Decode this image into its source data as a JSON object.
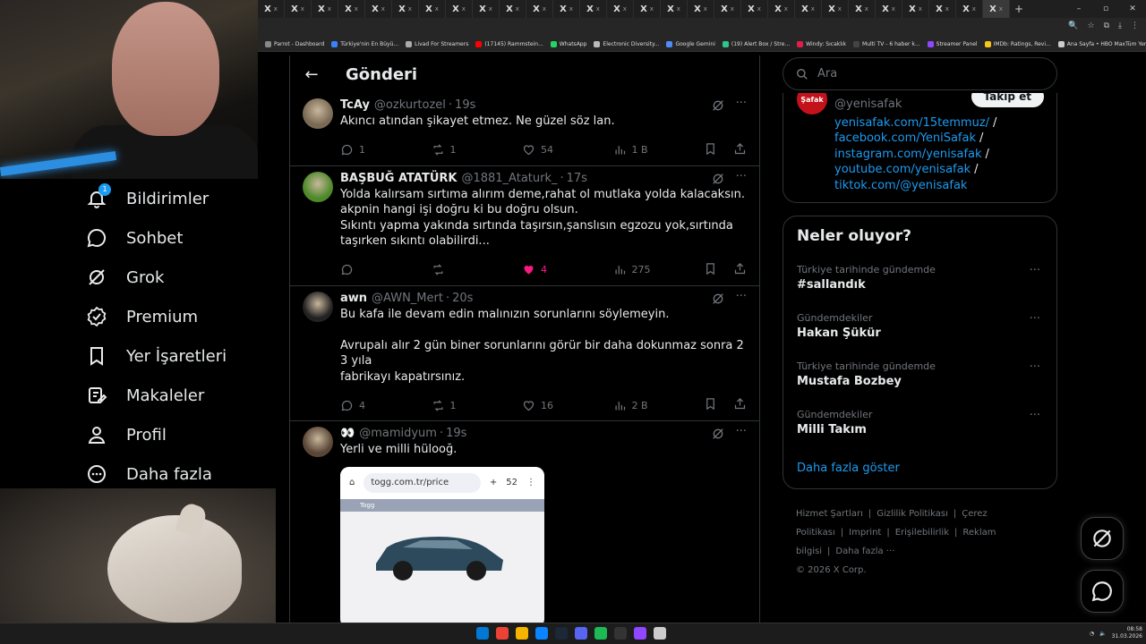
{
  "browser": {
    "tabs": [
      {
        "icon": "x-icon",
        "label": "X",
        "close": "x"
      },
      {
        "icon": "x-icon",
        "label": "X",
        "close": "x"
      },
      {
        "icon": "x-icon",
        "label": "X",
        "close": "x"
      },
      {
        "icon": "x-icon",
        "label": "X",
        "close": "x"
      },
      {
        "icon": "x-icon",
        "label": "X",
        "close": "x"
      },
      {
        "icon": "x-icon",
        "label": "X",
        "close": "x"
      },
      {
        "icon": "x-icon",
        "label": "X",
        "close": "x"
      },
      {
        "icon": "x-icon",
        "label": "X",
        "close": "x"
      },
      {
        "icon": "x-icon",
        "label": "X",
        "close": "x"
      },
      {
        "icon": "x-icon",
        "label": "X",
        "close": "x"
      },
      {
        "icon": "x-icon",
        "label": "X",
        "close": "x"
      },
      {
        "icon": "x-icon",
        "label": "X",
        "close": "x"
      },
      {
        "icon": "x-icon",
        "label": "X",
        "close": "x"
      },
      {
        "icon": "x-icon",
        "label": "X",
        "close": "x"
      },
      {
        "icon": "x-icon",
        "label": "X",
        "close": "x"
      },
      {
        "icon": "x-icon",
        "label": "X",
        "close": "x"
      },
      {
        "icon": "x-icon",
        "label": "X",
        "close": "x"
      },
      {
        "icon": "x-icon",
        "label": "X",
        "close": "x"
      },
      {
        "icon": "x-icon",
        "label": "X",
        "close": "x"
      },
      {
        "icon": "x-icon",
        "label": "X",
        "close": "x"
      },
      {
        "icon": "x-icon",
        "label": "X",
        "close": "x"
      },
      {
        "icon": "x-icon",
        "label": "X",
        "close": "x"
      },
      {
        "icon": "x-icon",
        "label": "X",
        "close": "x"
      },
      {
        "icon": "x-icon",
        "label": "X",
        "close": "x"
      },
      {
        "icon": "x-icon",
        "label": "X",
        "close": "x"
      },
      {
        "icon": "x-icon",
        "label": "X",
        "close": "x"
      },
      {
        "icon": "x-icon",
        "label": "X",
        "close": "x"
      },
      {
        "icon": "x-icon",
        "label": "X",
        "close": "x",
        "active": true
      }
    ],
    "new_tab": "+",
    "window_controls": [
      "–",
      "▫",
      "✕"
    ],
    "bookmarks": [
      {
        "label": "Parrot - Dashboard",
        "color": "#888888"
      },
      {
        "label": "Türkiye'nin En Büyü...",
        "color": "#3b82f6"
      },
      {
        "label": "Livad For Streamers",
        "color": "#aaaaaa"
      },
      {
        "label": "(17145) Rammstein...",
        "color": "#ff0000"
      },
      {
        "label": "WhatsApp",
        "color": "#25d366"
      },
      {
        "label": "Electronic Diversity...",
        "color": "#bbbbbb"
      },
      {
        "label": "Google Gemini",
        "color": "#4f8bf9"
      },
      {
        "label": "(19) Alert Box / Stre...",
        "color": "#31c48d"
      },
      {
        "label": "Windy: Sıcaklık",
        "color": "#e11d48"
      },
      {
        "label": "Multi TV - 6 haber k...",
        "color": "#444444"
      },
      {
        "label": "Streamer Panel",
        "color": "#9147ff"
      },
      {
        "label": "IMDb: Ratings, Revi...",
        "color": "#f5c518"
      },
      {
        "label": "Ana Sayfa • HBO Max",
        "color": "#cccccc"
      }
    ],
    "bookmarks_all": "Tüm Yer İşaretleri"
  },
  "nav": {
    "items": [
      {
        "label": "Bildirimler",
        "icon": "bell-icon",
        "badge": "1"
      },
      {
        "label": "Sohbet",
        "icon": "chat-icon"
      },
      {
        "label": "Grok",
        "icon": "grok-icon"
      },
      {
        "label": "Premium",
        "icon": "verified-icon"
      },
      {
        "label": "Yer İşaretleri",
        "icon": "bookmark-icon"
      },
      {
        "label": "Makaleler",
        "icon": "article-icon"
      },
      {
        "label": "Profil",
        "icon": "person-icon"
      },
      {
        "label": "Daha fazla",
        "icon": "more-circle-icon"
      }
    ]
  },
  "header": {
    "back": "←",
    "title": "Gönderi"
  },
  "tweets": [
    {
      "name": "TcAy",
      "handle": "@ozkurtozel",
      "time": "19s",
      "text": "Akıncı atından şikayet etmez. Ne güzel söz lan.",
      "replies": "1",
      "reposts": "1",
      "likes": "54",
      "views": "1 B",
      "liked": false,
      "avatar_color": "#7a6a55"
    },
    {
      "name": "BAŞBUĞ ATATÜRK",
      "handle": "@1881_Ataturk_",
      "time": "17s",
      "text": "Yolda kalırsam sırtıma alırım deme,rahat ol mutlaka yolda kalacaksın.\nakpnin hangi işi doğru ki bu doğru olsun.\nSıkıntı yapma yakında sırtında taşırsın,şanslısın egzozu yok,sırtında\ntaşırken sıkıntı olabilirdi...",
      "replies": "",
      "reposts": "",
      "likes": "4",
      "views": "275",
      "liked": true,
      "avatar_color": "#4e8a2a"
    },
    {
      "name": "awn",
      "handle": "@AWN_Mert",
      "time": "20s",
      "text": "Bu kafa ile devam edin malınızın sorunlarını söylemeyin.\n\nAvrupalı alır 2 gün biner sorunlarını görür bir daha dokunmaz sonra 2 3 yıla\nfabrikayı kapatırsınız.",
      "replies": "4",
      "reposts": "1",
      "likes": "16",
      "views": "2 B",
      "liked": false,
      "avatar_color": "#222222"
    },
    {
      "name": "👀",
      "handle": "@mamidyum",
      "time": "19s",
      "text": "Yerli ve milli hülooğ.",
      "liked": false,
      "avatar_color": "#5a4637",
      "media": {
        "url": "togg.com.tr/price",
        "tabs_count": "52",
        "site_label": "Togg",
        "car_color": "#2d4a5c"
      }
    }
  ],
  "search": {
    "placeholder": "Ara"
  },
  "profile_card": {
    "logo_text": "Şafak",
    "follow_label": "Takip et",
    "handle": "@yenisafak",
    "links": [
      "yenisafak.com/15temmuz/",
      "facebook.com/YeniSafak",
      "instagram.com/yenisafak",
      "youtube.com/yenisafak",
      "tiktok.com/@yenisafak"
    ],
    "separator": "/"
  },
  "trends": {
    "title": "Neler oluyor?",
    "items": [
      {
        "context": "Türkiye tarihinde gündemde",
        "title": "#sallandık"
      },
      {
        "context": "Gündemdekiler",
        "title": "Hakan Şükür"
      },
      {
        "context": "Türkiye tarihinde gündemde",
        "title": "Mustafa Bozbey"
      },
      {
        "context": "Gündemdekiler",
        "title": "Milli Takım"
      }
    ],
    "show_more": "Daha fazla göster"
  },
  "footer": {
    "links": [
      "Hizmet Şartları",
      "|",
      "Gizlilik Politikası",
      "|",
      "Çerez Politikası",
      "|",
      "Imprint",
      "|",
      "Erişilebilirlik",
      "|",
      "Reklam bilgisi",
      "|",
      "Daha fazla ···"
    ],
    "copyright": "© 2026 X Corp."
  },
  "taskbar": {
    "time": "08:58",
    "date": "31.03.2026",
    "app_colors": [
      "#0078d4",
      "#ea4335",
      "#f5b400",
      "#0a84ff",
      "#1b2838",
      "#5865f2",
      "#1db954",
      "#333333",
      "#9146ff",
      "#cccccc"
    ]
  },
  "colors": {
    "accent": "#1d9bf0",
    "like": "#f91880",
    "muted": "#71767b",
    "border": "#2f3336"
  }
}
